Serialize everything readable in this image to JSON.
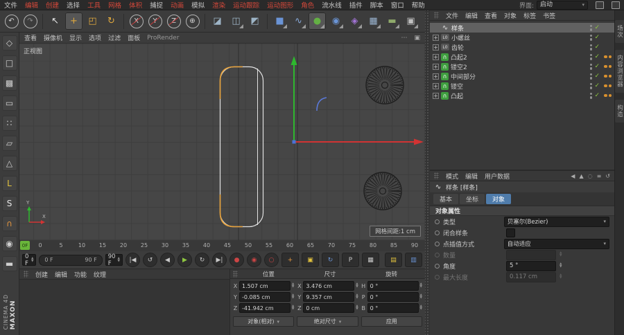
{
  "colors": {
    "menu-red": "#d4483a",
    "accent-orange": "#d9912e",
    "check-green": "#8ec641",
    "play-green": "#69b53a",
    "tab-blue": "#4f7cab"
  },
  "menubar": {
    "items": [
      {
        "label": "文件"
      },
      {
        "label": "编辑"
      },
      {
        "label": "创建"
      },
      {
        "label": "选择"
      },
      {
        "label": "工具"
      },
      {
        "label": "网格"
      },
      {
        "label": "体积"
      },
      {
        "label": "捕捉"
      },
      {
        "label": "动画"
      },
      {
        "label": "模拟"
      },
      {
        "label": "渲染"
      },
      {
        "label": "运动跟踪"
      },
      {
        "label": "运动图形"
      },
      {
        "label": "角色"
      },
      {
        "label": "流水线"
      },
      {
        "label": "插件"
      },
      {
        "label": "脚本"
      },
      {
        "label": "窗口"
      },
      {
        "label": "帮助"
      }
    ],
    "interface_label": "界面:",
    "interface_value": "启动"
  },
  "toolbar": {
    "icons": [
      {
        "name": "undo-icon",
        "glyph": "↶",
        "color": "#d0d0d0"
      },
      {
        "name": "redo-icon",
        "glyph": "↷",
        "color": "#8d8d8d"
      },
      {
        "name": "live-selection-icon",
        "glyph": "↖",
        "color": "#e6e6e6"
      },
      {
        "name": "move-icon",
        "glyph": "+",
        "color": "#e0a93e"
      },
      {
        "name": "scale-icon",
        "glyph": "◰",
        "color": "#e0a93e"
      },
      {
        "name": "rotate-icon",
        "glyph": "↻",
        "color": "#e0a93e"
      },
      {
        "name": "lock-x-icon",
        "glyph": "X",
        "color": "#d8d8d8"
      },
      {
        "name": "lock-y-icon",
        "glyph": "Y",
        "color": "#d8d8d8"
      },
      {
        "name": "lock-z-icon",
        "glyph": "Z",
        "color": "#d8d8d8"
      },
      {
        "name": "coord-system-icon",
        "glyph": "⊕",
        "color": "#d8d8d8"
      },
      {
        "name": "render-view-icon",
        "glyph": "◪",
        "color": "#9db4c6"
      },
      {
        "name": "render-region-icon",
        "glyph": "◫",
        "color": "#9db4c6"
      },
      {
        "name": "render-settings-icon",
        "glyph": "◩",
        "color": "#9db4c6"
      },
      {
        "name": "add-cube-icon",
        "glyph": "■",
        "color": "#6a94d6"
      },
      {
        "name": "add-spline-icon",
        "glyph": "∿",
        "color": "#86a8d8"
      },
      {
        "name": "add-generator-icon",
        "glyph": "●",
        "color": "#64b044"
      },
      {
        "name": "add-subdiv-icon",
        "glyph": "◉",
        "color": "#6a94d6"
      },
      {
        "name": "add-deformer-icon",
        "glyph": "◈",
        "color": "#a273d6"
      },
      {
        "name": "add-array-icon",
        "glyph": "▦",
        "color": "#9ab4d0"
      },
      {
        "name": "add-floor-icon",
        "glyph": "▬",
        "color": "#8faa6b"
      },
      {
        "name": "add-camera-icon",
        "glyph": "▣",
        "color": "#c0c0c0"
      },
      {
        "name": "add-light-icon",
        "glyph": "*",
        "color": "#e6d44a"
      },
      {
        "name": "layout-grid-icon",
        "glyph": "▤",
        "color": "#b0b0b0"
      },
      {
        "name": "layout-film-icon",
        "glyph": "▥",
        "color": "#b0b0b0"
      }
    ]
  },
  "left_toolbar": {
    "icons": [
      {
        "name": "make-editable-icon",
        "glyph": "◇",
        "color": "#cfcfcf"
      },
      {
        "name": "model-mode-icon",
        "glyph": "□",
        "color": "#cfcfcf"
      },
      {
        "name": "texture-mode-icon",
        "glyph": "▩",
        "color": "#cfcfcf"
      },
      {
        "name": "workplane-mode-icon",
        "glyph": "▭",
        "color": "#cfcfcf"
      },
      {
        "name": "points-mode-icon",
        "glyph": "∷",
        "color": "#cfcfcf"
      },
      {
        "name": "edges-mode-icon",
        "glyph": "▱",
        "color": "#cfcfcf"
      },
      {
        "name": "polygons-mode-icon",
        "glyph": "△",
        "color": "#cfcfcf"
      },
      {
        "name": "axis-mode-icon",
        "glyph": "L",
        "color": "#e4c43e"
      },
      {
        "name": "solo-mode-icon",
        "glyph": "S",
        "color": "#e6e6e6"
      },
      {
        "name": "snap-magnet-icon",
        "glyph": "∩",
        "color": "#e0933e"
      },
      {
        "name": "quantize-icon",
        "glyph": "◉",
        "color": "#cfcfcf"
      },
      {
        "name": "lock-workplane-icon",
        "glyph": "▬",
        "color": "#cfcfcf"
      }
    ]
  },
  "brand": {
    "maxon": "MAXON",
    "cinema": "CINEMA 4D"
  },
  "viewport": {
    "menu": [
      "查看",
      "摄像机",
      "显示",
      "选项",
      "过滤",
      "面板",
      "ProRender"
    ],
    "menu_icons": [
      {
        "name": "viewport-menu-icon",
        "glyph": "⋯"
      },
      {
        "name": "viewport-maximize-icon",
        "glyph": "▣"
      }
    ],
    "view_label": "正视图",
    "grid_label": "网格间距:1 cm",
    "axis_x": "X",
    "axis_y": "Y"
  },
  "timeline": {
    "ticks": [
      "0",
      "5",
      "10",
      "15",
      "20",
      "25",
      "30",
      "35",
      "40",
      "45",
      "50",
      "55",
      "60",
      "65",
      "70",
      "75",
      "80",
      "85",
      "90"
    ],
    "playhead": "0F"
  },
  "transport": {
    "current": "0 F",
    "range_start": "0 F",
    "range_end": "90 F",
    "end": "90 F",
    "buttons": [
      {
        "name": "goto-start-button",
        "glyph": "|◀",
        "color": "#c8c8c8"
      },
      {
        "name": "play-reverse-button",
        "glyph": "↺",
        "color": "#c8c8c8"
      },
      {
        "name": "previous-frame-button",
        "glyph": "◀",
        "color": "#c8c8c8"
      },
      {
        "name": "play-button",
        "glyph": "▶",
        "color": "#8ec641"
      },
      {
        "name": "next-frame-button",
        "glyph": "↻",
        "color": "#c8c8c8"
      },
      {
        "name": "goto-end-button",
        "glyph": "▶|",
        "color": "#c8c8c8"
      }
    ],
    "record": [
      {
        "name": "record-keyframe-button",
        "glyph": "●",
        "color": "#cc4545"
      },
      {
        "name": "autokey-button",
        "glyph": "◉",
        "color": "#cc4545"
      },
      {
        "name": "keyframe-selection-button",
        "glyph": "○",
        "color": "#cc4545"
      }
    ],
    "toggles": [
      {
        "name": "record-position-button",
        "glyph": "+",
        "color": "#e0933e"
      },
      {
        "name": "record-scale-button",
        "glyph": "▣",
        "color": "#e4c43e"
      },
      {
        "name": "record-rotation-button",
        "glyph": "↻",
        "color": "#6a94d6"
      },
      {
        "name": "record-parameter-button",
        "glyph": "P",
        "color": "#c8c8c8"
      },
      {
        "name": "record-pla-button",
        "glyph": "▦",
        "color": "#c8c8c8"
      }
    ],
    "right": [
      {
        "name": "key-interpolation-button",
        "glyph": "▤",
        "color": "#e4c43e"
      },
      {
        "name": "timeline-options-button",
        "glyph": "▥",
        "color": "#6a94d6"
      }
    ]
  },
  "material_panel": {
    "tabs": [
      "创建",
      "编辑",
      "功能",
      "纹理"
    ]
  },
  "coord": {
    "headers": [
      "位置",
      "尺寸",
      "旋转"
    ],
    "position": [
      {
        "label": "X",
        "value": "1.507 cm"
      },
      {
        "label": "Y",
        "value": "-0.085 cm"
      },
      {
        "label": "Z",
        "value": "-41.942 cm"
      }
    ],
    "size": [
      {
        "label": "X",
        "value": "3.476 cm"
      },
      {
        "label": "Y",
        "value": "9.357 cm"
      },
      {
        "label": "Z",
        "value": "0 cm"
      }
    ],
    "rotation": [
      {
        "label": "H",
        "value": "0 °"
      },
      {
        "label": "P",
        "value": "0 °"
      },
      {
        "label": "B",
        "value": "0 °"
      }
    ],
    "mode_object": "对象(相对)",
    "mode_size": "绝对尺寸",
    "apply": "应用"
  },
  "om": {
    "menu": [
      "文件",
      "编辑",
      "查看",
      "对象",
      "标签",
      "书签"
    ],
    "glyphs": {
      "expand": "+",
      "check": "✓",
      "lod": "L0",
      "generator": "∩",
      "spline": "∿"
    },
    "rows": [
      {
        "label": "样条"
      },
      {
        "label": "小螺丝"
      },
      {
        "label": "齿轮"
      },
      {
        "label": "凸起2"
      },
      {
        "label": "镂空2"
      },
      {
        "label": "中间部分"
      },
      {
        "label": "镂空"
      },
      {
        "label": "凸起"
      }
    ]
  },
  "am": {
    "menu": [
      "模式",
      "编辑",
      "用户数据"
    ],
    "icons": [
      {
        "name": "nav-back-icon",
        "glyph": "◀"
      },
      {
        "name": "nav-up-icon",
        "glyph": "▲"
      },
      {
        "name": "search-icon",
        "glyph": "◌"
      },
      {
        "name": "settings-icon",
        "glyph": "≡"
      },
      {
        "name": "history-icon",
        "glyph": "↺"
      }
    ],
    "title": "样条 [样条]",
    "tabs": [
      "基本",
      "坐标",
      "对象"
    ],
    "section": "对象属性",
    "rows": {
      "type_label": "类型",
      "type_value": "贝塞尔(Bezier)",
      "close_label": "闭合样条",
      "interp_label": "点插值方式",
      "interp_value": "自动适应",
      "count_label": "数量",
      "count_value": "",
      "angle_label": "角度",
      "angle_value": "5 °",
      "maxlen_label": "最大长度",
      "maxlen_value": "0.117 cm"
    }
  },
  "right_rail": {
    "tabs": [
      "场次",
      "内容浏览器",
      "构造"
    ]
  }
}
